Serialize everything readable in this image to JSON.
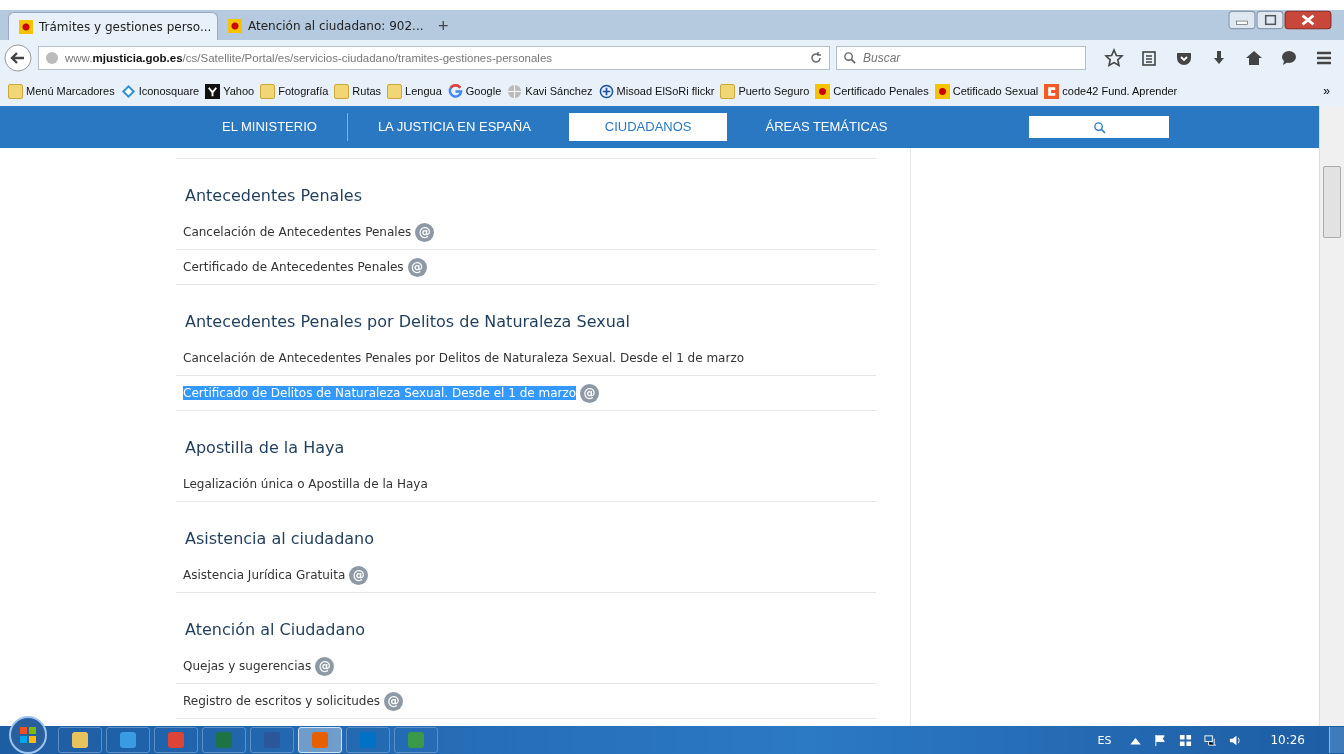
{
  "tabs": [
    {
      "title": "Trámites y gestiones perso...",
      "selected": true
    },
    {
      "title": "Atención al ciudadano: 902...",
      "selected": false
    }
  ],
  "new_tab": "+",
  "address": "www.**mjusticia.gob.es**/cs/Satellite/Portal/es/servicios-ciudadano/tramites-gestiones-personales",
  "search": {
    "placeholder": "Buscar"
  },
  "bookmarks": [
    {
      "label": "Menú Marcadores",
      "kind": "folder"
    },
    {
      "label": "Iconosquare",
      "kind": "diamond"
    },
    {
      "label": "Yahoo",
      "kind": "yahoo"
    },
    {
      "label": "Fotografía",
      "kind": "folder"
    },
    {
      "label": "Rutas",
      "kind": "folder"
    },
    {
      "label": "Lengua",
      "kind": "folder"
    },
    {
      "label": "Google",
      "kind": "google"
    },
    {
      "label": "Kavi Sánchez",
      "kind": "globe"
    },
    {
      "label": "Misoad ElSoRi flickr",
      "kind": "plus"
    },
    {
      "label": "Puerto Seguro",
      "kind": "folder"
    },
    {
      "label": "Certificado Penales",
      "kind": "crest"
    },
    {
      "label": "Cetificado Sexual",
      "kind": "crest"
    },
    {
      "label": "code42 Fund. Aprender",
      "kind": "code"
    }
  ],
  "bookmarks_more": "»",
  "site_nav": [
    {
      "label": "EL MINISTERIO",
      "selected": false
    },
    {
      "label": "LA JUSTICIA EN ESPAÑA",
      "selected": false
    },
    {
      "label": "CIUDADANOS",
      "selected": true
    },
    {
      "label": "ÁREAS TEMÁTICAS",
      "selected": false
    }
  ],
  "sections": [
    {
      "heading": "Antecedentes Penales",
      "items": [
        {
          "label": "Cancelación de Antecedentes Penales",
          "online": true,
          "highlighted": false
        },
        {
          "label": "Certificado de Antecedentes Penales",
          "online": true,
          "highlighted": false
        }
      ]
    },
    {
      "heading": "Antecedentes Penales por Delitos de Naturaleza Sexual",
      "items": [
        {
          "label": "Cancelación de Antecedentes Penales por Delitos de Naturaleza Sexual. Desde el 1 de marzo",
          "online": false,
          "highlighted": false
        },
        {
          "label": "Certificado de Delitos de Naturaleza Sexual. Desde el 1 de marzo",
          "online": true,
          "highlighted": true
        }
      ]
    },
    {
      "heading": "Apostilla de la Haya",
      "items": [
        {
          "label": "Legalización única o Apostilla de la Haya",
          "online": false,
          "highlighted": false
        }
      ]
    },
    {
      "heading": "Asistencia al ciudadano",
      "items": [
        {
          "label": "Asistencia Jurídica Gratuita",
          "online": true,
          "highlighted": false
        }
      ]
    },
    {
      "heading": "Atención al Ciudadano",
      "items": [
        {
          "label": "Quejas y sugerencias",
          "online": true,
          "highlighted": false
        },
        {
          "label": "Registro de escritos y solicitudes",
          "online": true,
          "highlighted": false
        }
      ]
    }
  ],
  "online_badge": "@",
  "taskbar_apps": [
    {
      "kind": "explorer",
      "selected": false
    },
    {
      "kind": "ie",
      "selected": false
    },
    {
      "kind": "chrome",
      "selected": false
    },
    {
      "kind": "excel",
      "selected": false
    },
    {
      "kind": "word",
      "selected": false
    },
    {
      "kind": "firefox",
      "selected": true
    },
    {
      "kind": "outlook",
      "selected": false
    },
    {
      "kind": "people",
      "selected": false
    }
  ],
  "tray": {
    "language": "ES",
    "clock": "10:26"
  }
}
